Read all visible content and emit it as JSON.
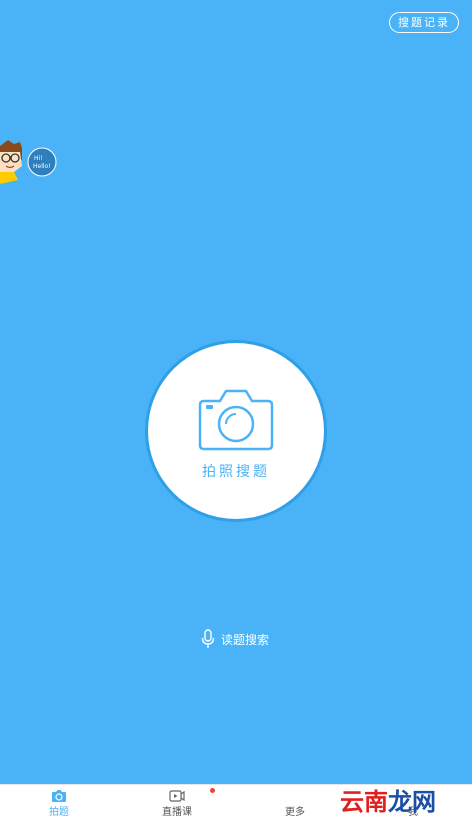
{
  "header": {
    "history_label": "搜题记录"
  },
  "mascot": {
    "bubble_text": "Hi!\nHello!"
  },
  "camera": {
    "label": "拍照搜题"
  },
  "voice": {
    "label": "读题搜索"
  },
  "tabs": [
    {
      "label": "拍题",
      "icon": "camera-tab-icon",
      "active": true
    },
    {
      "label": "直播课",
      "icon": "video-tab-icon",
      "active": false,
      "badge": "red-dot"
    },
    {
      "label": "更多",
      "icon": "more-tab-icon",
      "active": false
    },
    {
      "label": "我",
      "icon": "user-tab-icon",
      "active": false
    }
  ],
  "watermark": {
    "text1": "云南",
    "text2": "龙网"
  },
  "colors": {
    "primary": "#4ab3f7",
    "white": "#ffffff",
    "badge": "#f44336"
  }
}
